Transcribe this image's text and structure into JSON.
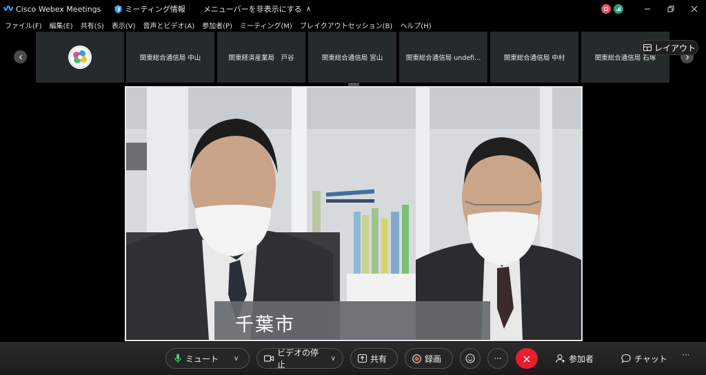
{
  "titlebar": {
    "app_title": "Cisco Webex Meetings",
    "meeting_info": "ミーティング情報",
    "hide_menu": "メニューバーを非表示にする",
    "hide_menu_chevron": "∧"
  },
  "menubar": {
    "items": [
      "ファイル(F)",
      "編集(E)",
      "共有(S)",
      "表示(V)",
      "音声とビデオ(A)",
      "参加者(P)",
      "ミーティング(M)",
      "ブレイクアウトセッション(B)",
      "ヘルプ(H)"
    ]
  },
  "participants": [
    {
      "name": "関東総合通信局 中山"
    },
    {
      "name": "関東経済産業局　戸谷"
    },
    {
      "name": "関東総合通信局 宮山"
    },
    {
      "name": "関東総合通信局 undefi..."
    },
    {
      "name": "関東総合通信局 中村"
    },
    {
      "name": "関東総合通信局 石塚"
    }
  ],
  "layout_button": "レイアウト",
  "video": {
    "caption": "千葉市"
  },
  "toolbar": {
    "mute": "ミュート",
    "stop_video": "ビデオの停止",
    "share": "共有",
    "record": "録画",
    "more": "···",
    "end": "×",
    "participants": "参加者",
    "chat": "チャット",
    "overflow": "···"
  },
  "colors": {
    "end_button": "#e81d2d",
    "tile_bg": "#252a2a",
    "toolbar_bg": "#222222",
    "mute_icon": "#3dd57a"
  }
}
